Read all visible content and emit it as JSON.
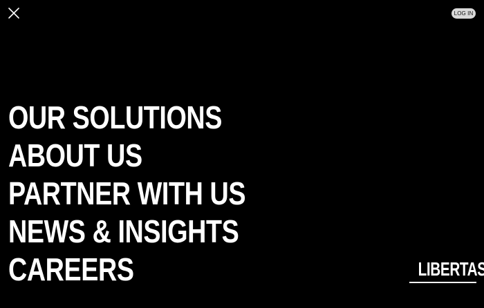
{
  "header": {
    "close_icon": "close-icon",
    "login_label": "LOG IN"
  },
  "menu": {
    "items": [
      {
        "label": "OUR SOLUTIONS"
      },
      {
        "label": "ABOUT US"
      },
      {
        "label": "PARTNER WITH US"
      },
      {
        "label": "NEWS & INSIGHTS"
      },
      {
        "label": "CAREERS"
      }
    ]
  },
  "brand": {
    "name": "LIBERTAS"
  },
  "colors": {
    "background": "#000000",
    "text": "#ffffff",
    "login_button": "#d9d9d9"
  }
}
